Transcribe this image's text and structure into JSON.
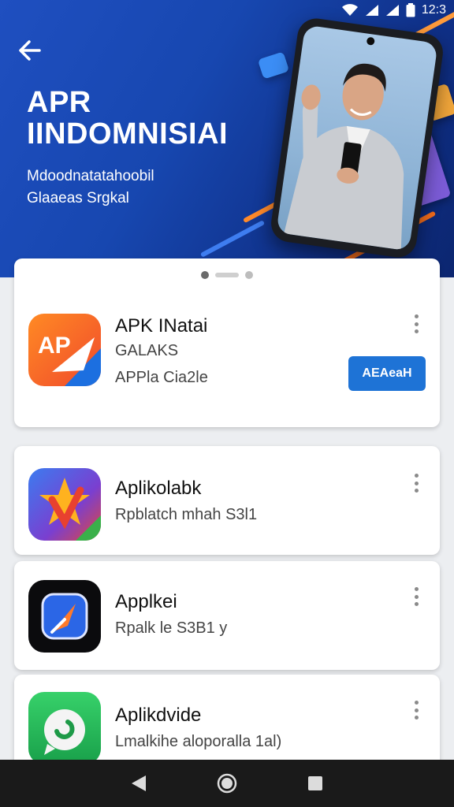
{
  "status_bar": {
    "time": "12:3"
  },
  "hero": {
    "title_line1": "APR",
    "title_line2": "IINDOMNISIAI",
    "subtitle_line1": "Mdoodnatatahoobil",
    "subtitle_line2": "Glaaeas Srgkal"
  },
  "carousel": {
    "count": 3,
    "active": 0
  },
  "featured_app": {
    "name": "APK INatai",
    "developer": "GALAKS",
    "meta": "APPla Cia2le",
    "action_label": "AEAeaH"
  },
  "apps": [
    {
      "name": "Aplikolabk",
      "desc": "Rpblatch mhah S3l1"
    },
    {
      "name": "Applkei",
      "desc": "Rpalk le S3B1 y"
    },
    {
      "name": "Aplikdvide",
      "desc": "Lmalkihe aloporalla 1al)"
    }
  ],
  "colors": {
    "hero_bg": "#1747b0",
    "accent": "#1e73d6",
    "nav_bg": "#1a1a1a"
  },
  "icons": {
    "back": "arrow-left-icon",
    "more": "more-vertical-icon",
    "nav_back": "triangle-back-icon",
    "nav_home": "circle-home-icon",
    "nav_recents": "square-recents-icon"
  }
}
